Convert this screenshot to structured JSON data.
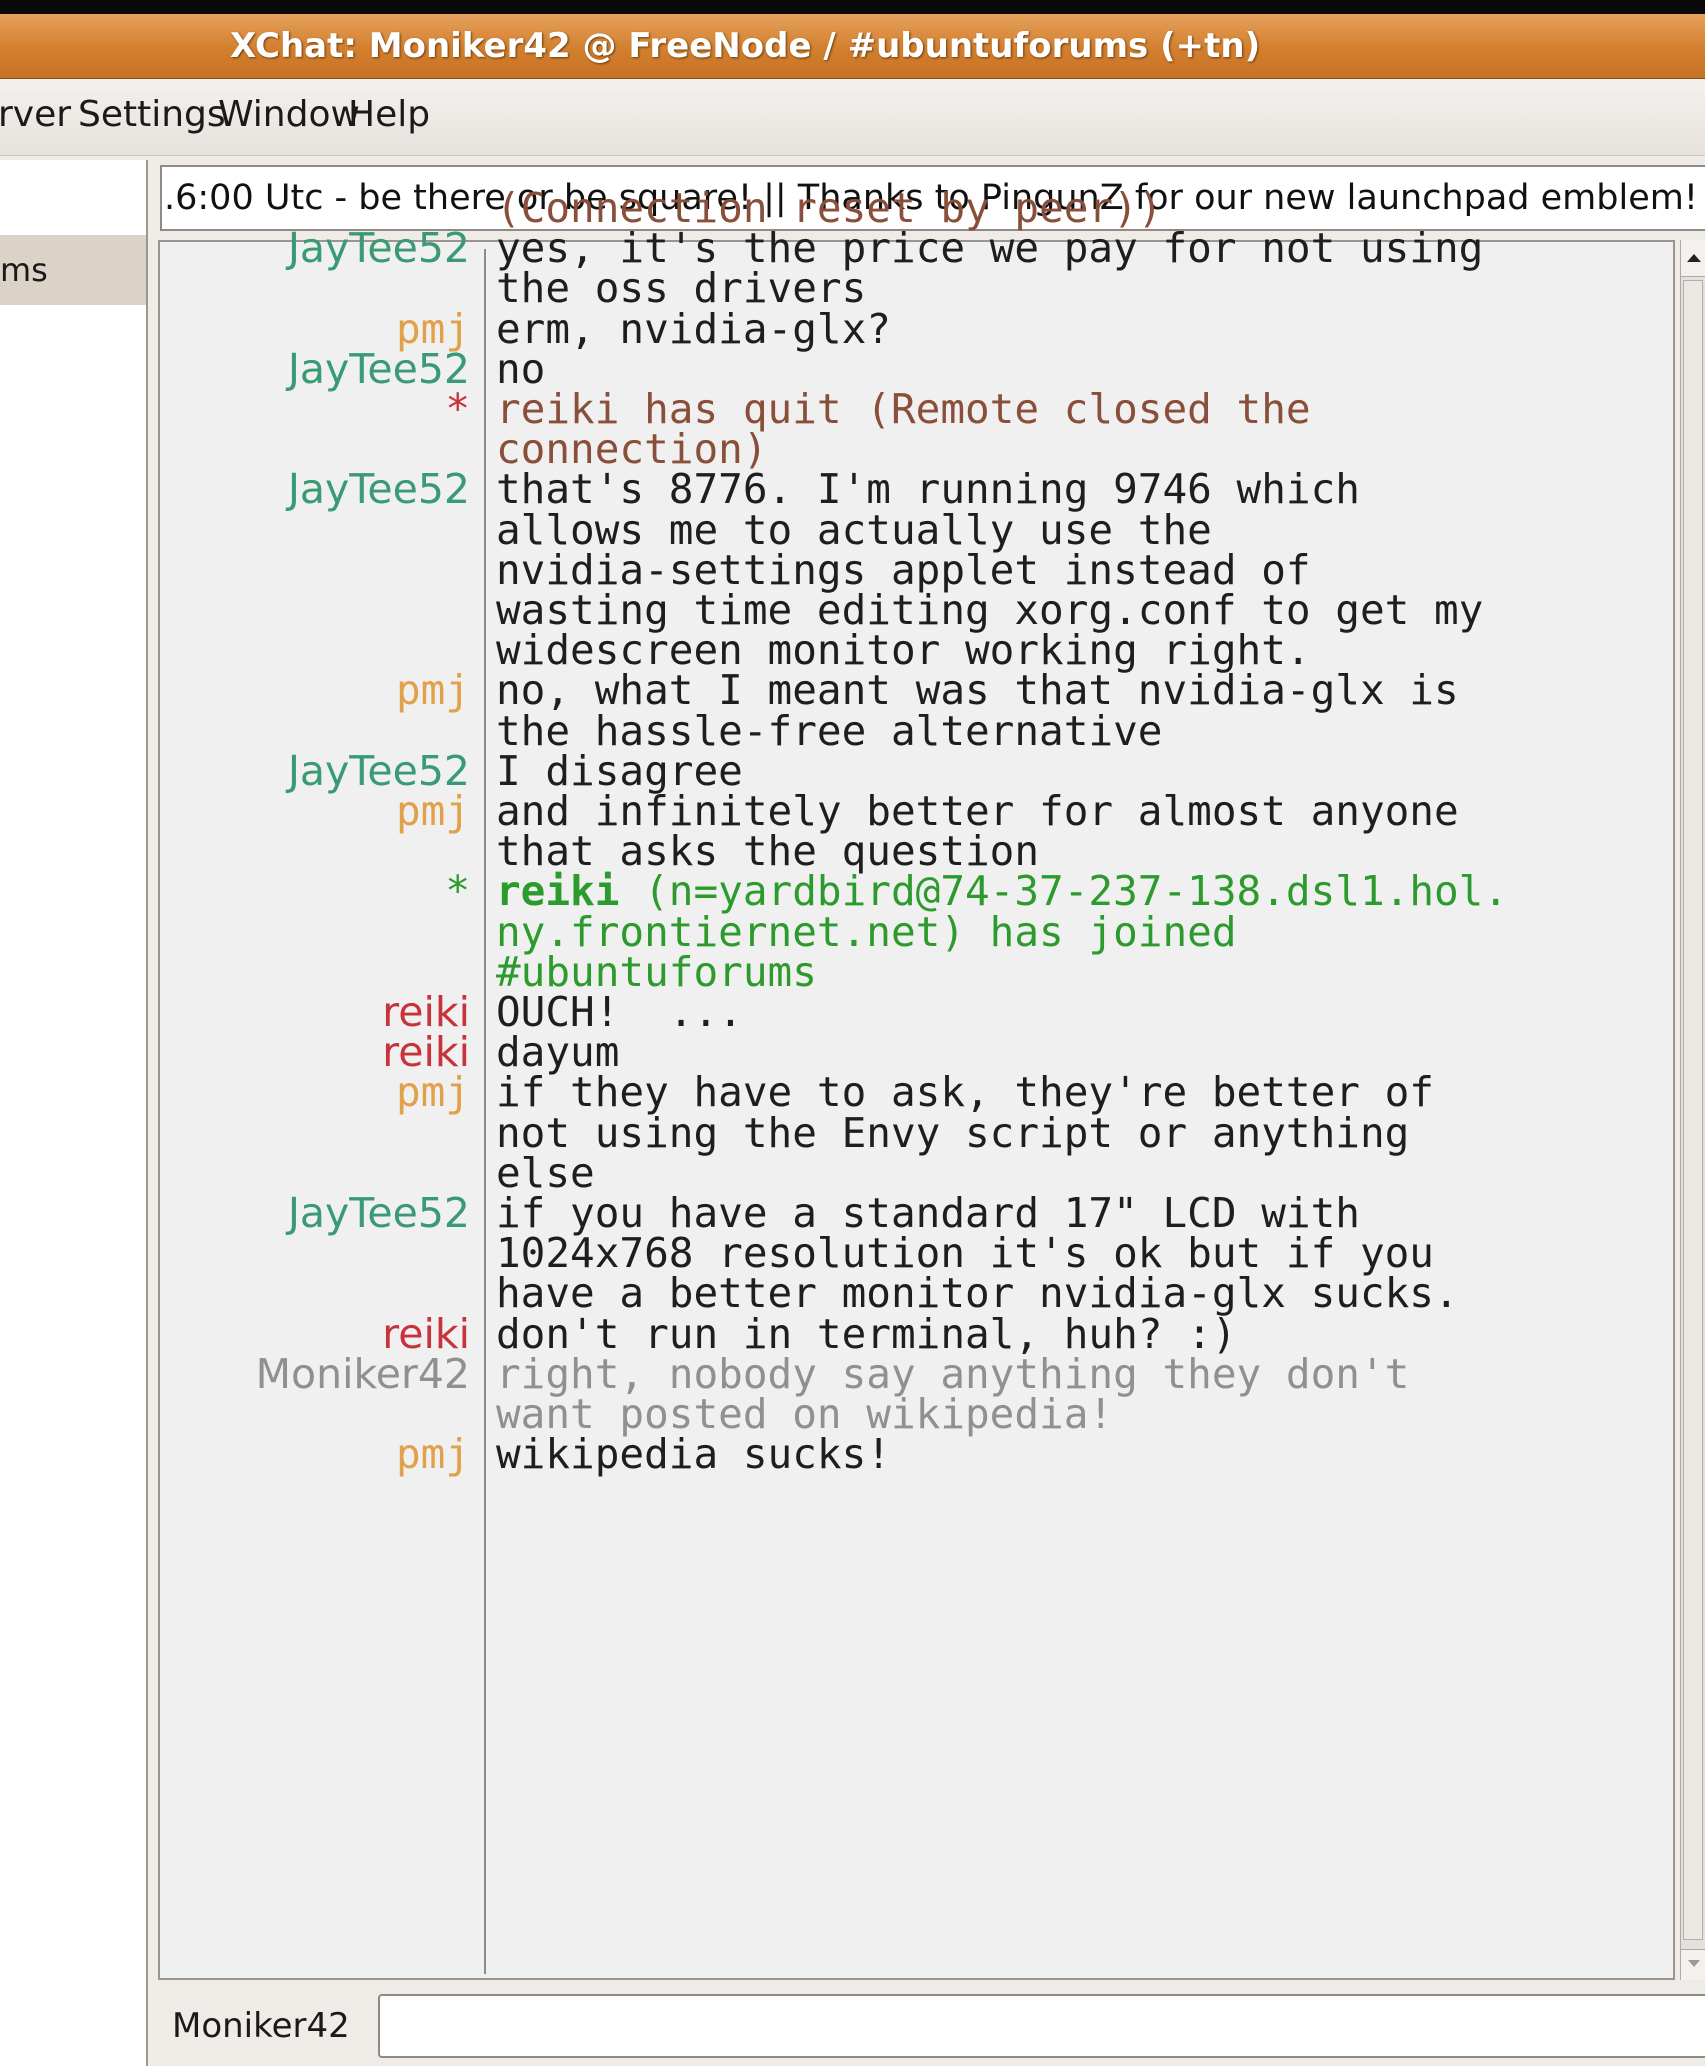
{
  "window": {
    "title": "XChat: Moniker42 @ FreeNode / #ubuntuforums (+tn)"
  },
  "menu": [
    "rver",
    "Settings",
    "Window",
    "Help"
  ],
  "channel_list": {
    "selected": "ms"
  },
  "topic": ".6:00 Utc - be there or be square! || Thanks to PingunZ for our new launchpad emblem!",
  "colors": {
    "JayTee52": "#3a9a76",
    "pmj": "#e0a14a",
    "reiki": "#c8323a",
    "Moniker42": "#909090",
    "star": "#c8323a",
    "text": "#1e1e1e",
    "quit": "#8a4f3a",
    "join": "#2d9a2d"
  },
  "lines": [
    {
      "nick": "",
      "text": "(Connection reset by peer))",
      "kind": "quit"
    },
    {
      "nick": "JayTee52",
      "text": "yes, it's the price we pay for not using",
      "kind": "text"
    },
    {
      "nick": "",
      "text": "the oss drivers",
      "kind": "text"
    },
    {
      "nick": "pmj",
      "text": "erm, nvidia-glx?",
      "kind": "text"
    },
    {
      "nick": "JayTee52",
      "text": "no",
      "kind": "text"
    },
    {
      "nick": "*",
      "text": "reiki has quit (Remote closed the",
      "kind": "quit"
    },
    {
      "nick": "",
      "text": "connection)",
      "kind": "quit"
    },
    {
      "nick": "JayTee52",
      "text": "that's 8776. I'm running 9746 which",
      "kind": "text"
    },
    {
      "nick": "",
      "text": "allows me to actually use the",
      "kind": "text"
    },
    {
      "nick": "",
      "text": "nvidia-settings applet instead of",
      "kind": "text"
    },
    {
      "nick": "",
      "text": "wasting time editing xorg.conf to get my",
      "kind": "text"
    },
    {
      "nick": "",
      "text": "widescreen monitor working right.",
      "kind": "text"
    },
    {
      "nick": "pmj",
      "text": "no, what I meant was that nvidia-glx is",
      "kind": "text"
    },
    {
      "nick": "",
      "text": "the hassle-free alternative",
      "kind": "text"
    },
    {
      "nick": "JayTee52",
      "text": "I disagree",
      "kind": "text"
    },
    {
      "nick": "pmj",
      "text": "and infinitely better for almost anyone",
      "kind": "text"
    },
    {
      "nick": "",
      "text": "that asks the question",
      "kind": "text"
    },
    {
      "nick": "*",
      "text": "reiki",
      "text2": " (n=yardbird@74-37-237-138.dsl1.hol.",
      "kind": "join"
    },
    {
      "nick": "",
      "text": "ny.frontiernet.net) has joined",
      "kind": "join"
    },
    {
      "nick": "",
      "text": "#ubuntuforums",
      "kind": "join"
    },
    {
      "nick": "reiki",
      "text": "OUCH!  ...",
      "kind": "text"
    },
    {
      "nick": "reiki",
      "text": "dayum",
      "kind": "text"
    },
    {
      "nick": "pmj",
      "text": "if they have to ask, they're better of",
      "kind": "text"
    },
    {
      "nick": "",
      "text": "not using the Envy script or anything",
      "kind": "text"
    },
    {
      "nick": "",
      "text": "else",
      "kind": "text"
    },
    {
      "nick": "JayTee52",
      "text": "if you have a standard 17\" LCD with",
      "kind": "text"
    },
    {
      "nick": "",
      "text": "1024x768 resolution it's ok but if you",
      "kind": "text"
    },
    {
      "nick": "",
      "text": "have a better monitor nvidia-glx sucks.",
      "kind": "text"
    },
    {
      "nick": "reiki",
      "text": "don't run in terminal, huh? :)",
      "kind": "text"
    },
    {
      "nick": "Moniker42",
      "text": "right, nobody say anything they don't",
      "kind": "self"
    },
    {
      "nick": "",
      "text": "want posted on wikipedia!",
      "kind": "self"
    },
    {
      "nick": "pmj",
      "text": "wikipedia sucks!",
      "kind": "text"
    }
  ],
  "input": {
    "nick": "Moniker42",
    "value": ""
  }
}
